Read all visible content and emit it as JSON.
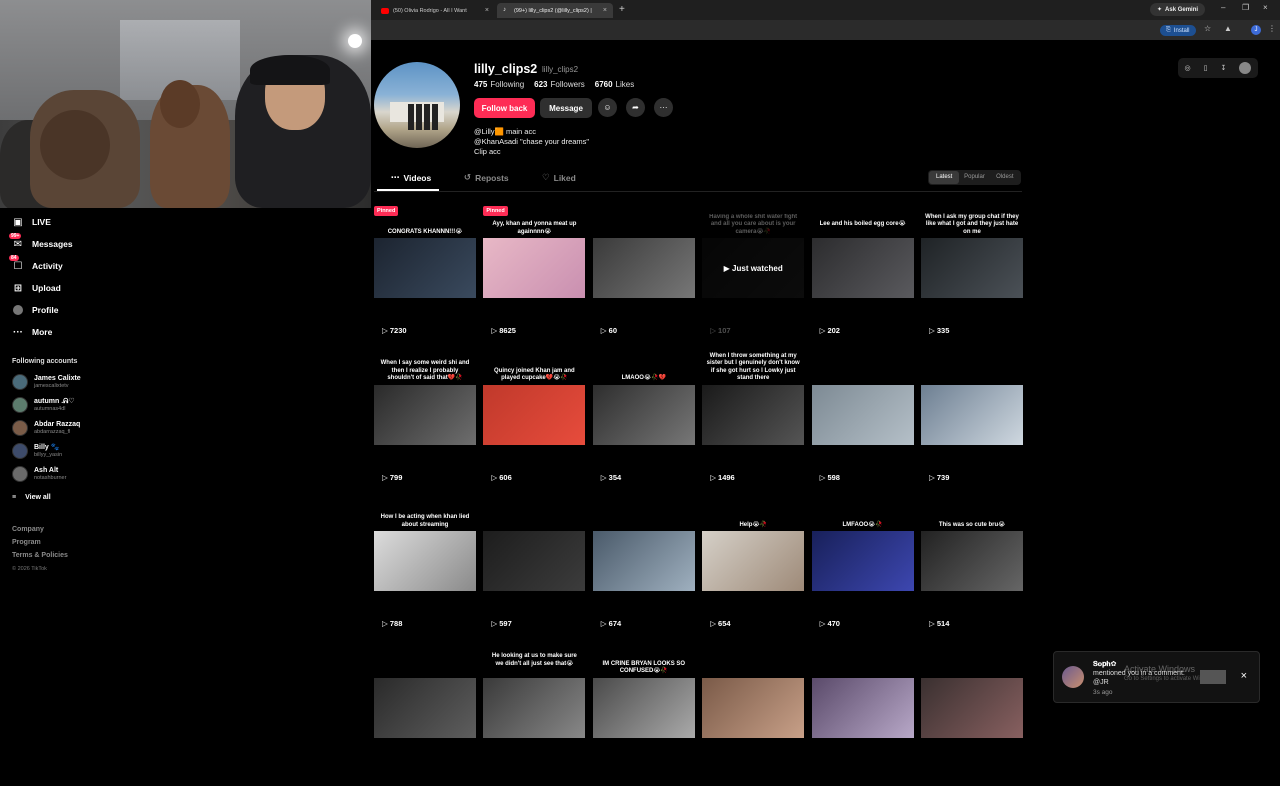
{
  "browser": {
    "tabs": [
      {
        "label": "(50) Olivia Rodrigo - All I Want",
        "icon": "youtube-icon"
      },
      {
        "label": "(99+) lilly_clips2 (@lilly_clips2) |",
        "icon": "tiktok-icon"
      }
    ],
    "ask_gemini": "Ask Gemini",
    "install": "Install",
    "profile_initial": "J"
  },
  "sidebar": {
    "nav": [
      {
        "label": "LIVE",
        "icon": "live-icon"
      },
      {
        "label": "Messages",
        "icon": "messages-icon",
        "badge": "99+"
      },
      {
        "label": "Activity",
        "icon": "activity-icon",
        "badge": "84"
      },
      {
        "label": "Upload",
        "icon": "upload-icon"
      },
      {
        "label": "Profile",
        "icon": "profile-icon"
      },
      {
        "label": "More",
        "icon": "more-icon"
      }
    ],
    "following_header": "Following accounts",
    "accounts": [
      {
        "name": "James Calixte",
        "handle": "jamescalixtetv"
      },
      {
        "name": "autumn .ᕱ♡",
        "handle": "autumnas4dl"
      },
      {
        "name": "Abdar Razzaq",
        "handle": "abdarrazzaq_fl"
      },
      {
        "name": "Billy 🐾",
        "handle": "billyy_yasin"
      },
      {
        "name": "Ash Alt",
        "handle": "notashburner"
      }
    ],
    "view_all": "View all",
    "footer_links": [
      "Company",
      "Program",
      "Terms & Policies"
    ],
    "copyright": "© 2026 TikTok"
  },
  "profile": {
    "username": "lilly_clips2",
    "handle": "lilly_clips2",
    "following_count": "475",
    "following_label": "Following",
    "followers_count": "623",
    "followers_label": "Followers",
    "likes_count": "6760",
    "likes_label": "Likes",
    "follow_back": "Follow back",
    "message": "Message",
    "bio": [
      "@Lilly🟧 main acc",
      "@KhanAsadi \"chase your dreams\"",
      "Clip acc"
    ]
  },
  "tabs": [
    {
      "label": "Videos",
      "icon": "grid-icon"
    },
    {
      "label": "Reposts",
      "icon": "repost-icon"
    },
    {
      "label": "Liked",
      "icon": "heart-icon"
    }
  ],
  "sort": [
    "Latest",
    "Popular",
    "Oldest"
  ],
  "videos": [
    {
      "caption": "CONGRATS KHANNN!!!😭",
      "views": "7230",
      "pinned": true
    },
    {
      "caption": "Ayy, khan and yonna meat up againnnn😭",
      "views": "8625",
      "pinned": true
    },
    {
      "caption": "",
      "views": "60"
    },
    {
      "caption": "Having a whole shit water fight and all you care about is your camera😭🥀",
      "views": "107",
      "watched": true
    },
    {
      "caption": "Lee and his boiled egg core😭",
      "views": "202"
    },
    {
      "caption": "When I ask my group chat if they like what I got and they just hate on me",
      "views": "335"
    },
    {
      "caption": "When I say some weird shi and then I realize I probably shouldn't of said that💔🥀",
      "views": "799"
    },
    {
      "caption": "Quincy joined Khan jam and played cupcake💔😭🥀",
      "views": "606"
    },
    {
      "caption": "LMAOO😭🥀💔",
      "views": "354"
    },
    {
      "caption": "When I throw something at my sister but I genuinely don't know if she got hurt so I Lowky just stand there",
      "views": "1496"
    },
    {
      "caption": "",
      "views": "598"
    },
    {
      "caption": "",
      "views": "739"
    },
    {
      "caption": "How I be acting when khan lied about streaming",
      "views": "788"
    },
    {
      "caption": "",
      "views": "597"
    },
    {
      "caption": "",
      "views": "674"
    },
    {
      "caption": "Help😭🥀",
      "views": "654"
    },
    {
      "caption": "LMFAOO😭🥀",
      "views": "470"
    },
    {
      "caption": "This was so cute bru😭",
      "views": "514"
    },
    {
      "caption": "",
      "views": ""
    },
    {
      "caption": "He looking at us to make sure we didn't all just see that😭",
      "views": ""
    },
    {
      "caption": "IM CRINE BRYAN LOOKS SO CONFUSED😭🥀",
      "views": ""
    },
    {
      "caption": "",
      "views": ""
    },
    {
      "caption": "",
      "views": ""
    },
    {
      "caption": "",
      "views": ""
    }
  ],
  "labels": {
    "pinned": "Pinned",
    "just_watched": "Just watched"
  },
  "toast": {
    "name": "𝐒𝐨𝐩𝐡✿",
    "message": "mentioned you in a comment: @JR",
    "time": "3s ago",
    "watermark": "Activate Windows",
    "watermark_sub": "Go to Settings to activate Windows."
  },
  "colors": {
    "accent": "#fe2c55",
    "background": "#000000",
    "button_dark": "#2f2f2f"
  }
}
